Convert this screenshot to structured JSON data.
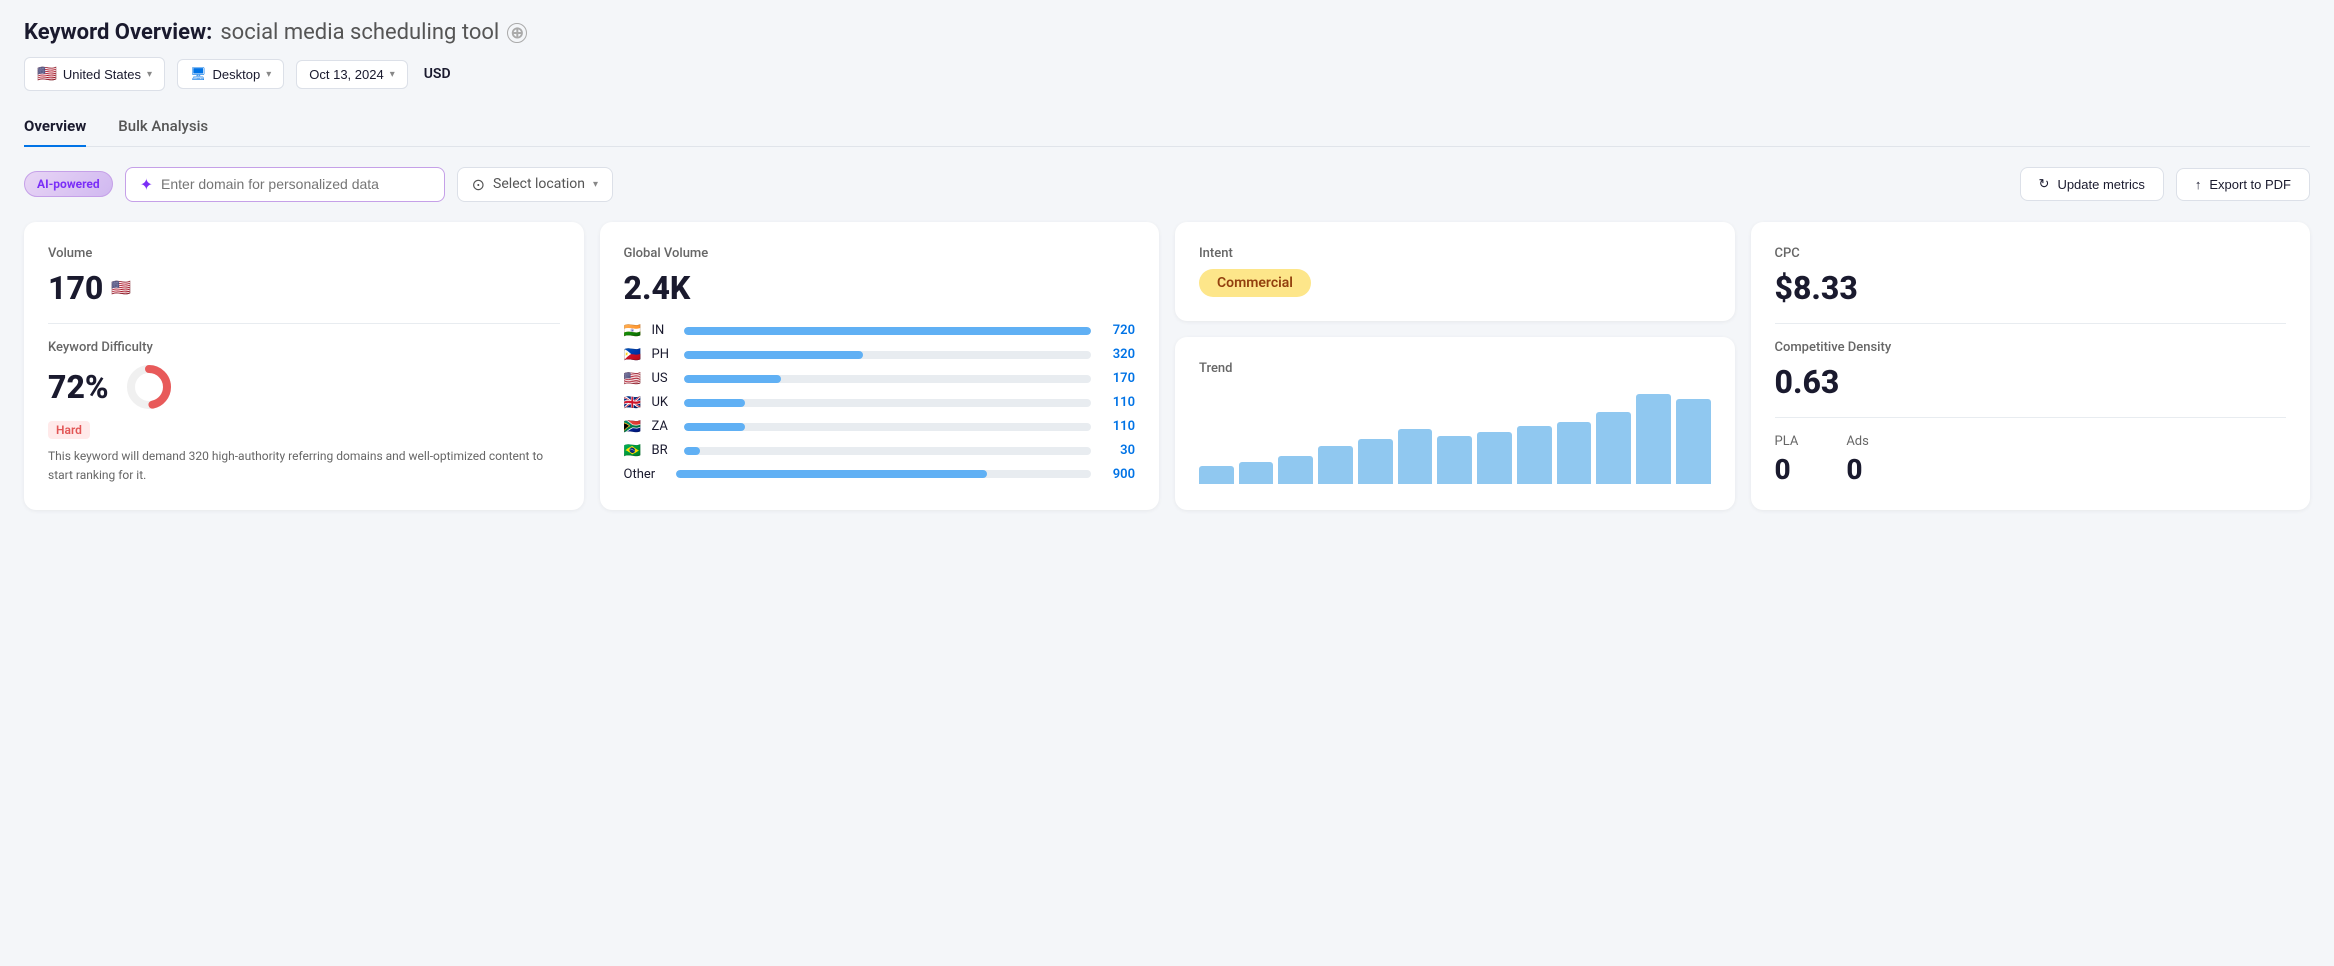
{
  "header": {
    "title_prefix": "Keyword Overview:",
    "title_query": "social media scheduling tool",
    "add_button_label": "+",
    "country": "United States",
    "device": "Desktop",
    "date": "Oct 13, 2024",
    "currency": "USD"
  },
  "tabs": [
    {
      "id": "overview",
      "label": "Overview",
      "active": true
    },
    {
      "id": "bulk",
      "label": "Bulk Analysis",
      "active": false
    }
  ],
  "action_bar": {
    "ai_badge": "AI-powered",
    "domain_placeholder": "Enter domain for personalized data",
    "location_placeholder": "Select location",
    "update_btn": "Update metrics",
    "export_btn": "Export to PDF"
  },
  "cards": {
    "volume": {
      "label": "Volume",
      "value": "170"
    },
    "keyword_difficulty": {
      "label": "Keyword Difficulty",
      "value": "72%",
      "difficulty_label": "Hard",
      "donut_pct": 72,
      "description": "This keyword will demand 320 high-authority referring domains and well-optimized content to start ranking for it."
    },
    "global_volume": {
      "label": "Global Volume",
      "value": "2.4K",
      "countries": [
        {
          "flag": "🇮🇳",
          "code": "IN",
          "value": "720",
          "bar_pct": 100
        },
        {
          "flag": "🇵🇭",
          "code": "PH",
          "value": "320",
          "bar_pct": 44
        },
        {
          "flag": "🇺🇸",
          "code": "US",
          "value": "170",
          "bar_pct": 24
        },
        {
          "flag": "🇬🇧",
          "code": "UK",
          "value": "110",
          "bar_pct": 15
        },
        {
          "flag": "🇿🇦",
          "code": "ZA",
          "value": "110",
          "bar_pct": 15
        },
        {
          "flag": "🇧🇷",
          "code": "BR",
          "value": "30",
          "bar_pct": 4
        }
      ],
      "other_label": "Other",
      "other_value": "900",
      "other_bar_pct": 75
    },
    "intent": {
      "label": "Intent",
      "value": "Commercial"
    },
    "trend": {
      "label": "Trend",
      "bars": [
        18,
        22,
        28,
        38,
        45,
        55,
        48,
        52,
        58,
        62,
        72,
        90,
        85
      ]
    },
    "cpc": {
      "label": "CPC",
      "value": "$8.33"
    },
    "competitive_density": {
      "label": "Competitive Density",
      "value": "0.63"
    },
    "pla": {
      "label": "PLA",
      "value": "0"
    },
    "ads": {
      "label": "Ads",
      "value": "0"
    }
  },
  "colors": {
    "accent_blue": "#0073e6",
    "purple": "#7b2ff7",
    "bar_blue": "#60b0f4",
    "donut_red": "#e85a5a",
    "donut_bg": "#f0f0f0",
    "intent_bg": "#fde68a",
    "intent_text": "#92400e"
  }
}
